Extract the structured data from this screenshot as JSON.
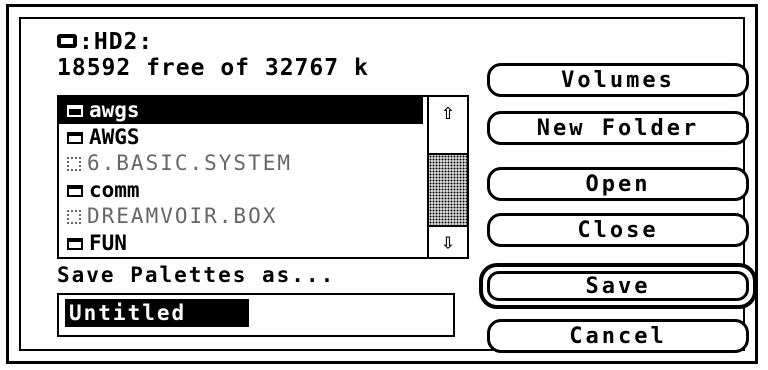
{
  "volume": {
    "name": ":HD2:",
    "free_text": "18592 free of 32767 k"
  },
  "files": [
    {
      "label": "awgs",
      "kind": "folder",
      "selected": true
    },
    {
      "label": "AWGS",
      "kind": "folder",
      "selected": false
    },
    {
      "label": "6.BASIC.SYSTEM",
      "kind": "file-dim",
      "selected": false
    },
    {
      "label": "comm",
      "kind": "folder",
      "selected": false
    },
    {
      "label": "DREAMVOIR.BOX",
      "kind": "file-dim",
      "selected": false
    },
    {
      "label": "FUN",
      "kind": "folder",
      "selected": false
    }
  ],
  "prompt": "Save Palettes as...",
  "filename": {
    "value": "Untitled"
  },
  "buttons": {
    "volumes": "Volumes",
    "new_folder": "New Folder",
    "open": "Open",
    "close": "Close",
    "save": "Save",
    "cancel": "Cancel"
  },
  "icons": {
    "up": "up-arrow-icon",
    "down": "down-arrow-icon",
    "volume": "hard-disk-icon"
  }
}
